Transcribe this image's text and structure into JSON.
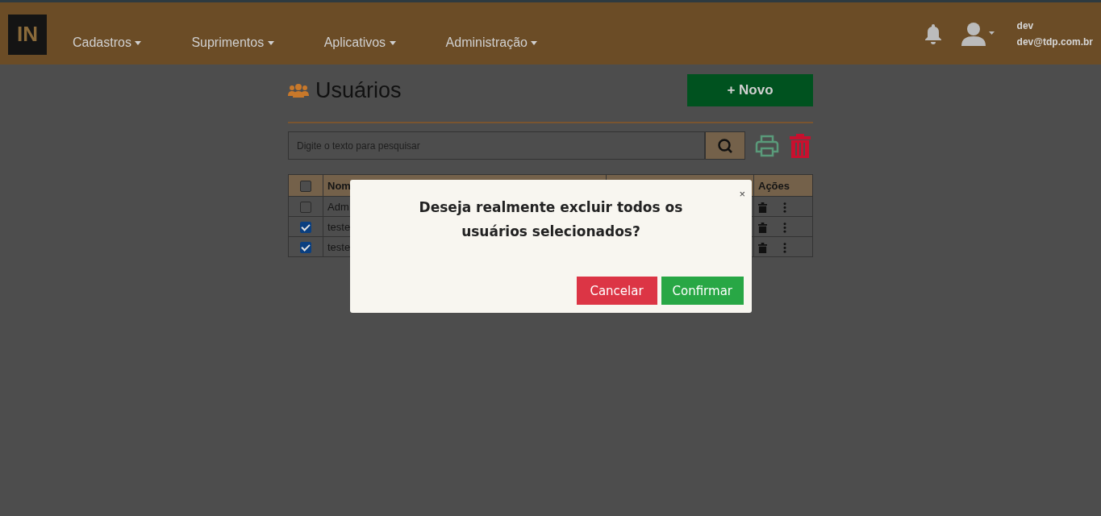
{
  "navbar": {
    "logo": "IN",
    "menus": [
      {
        "label": "Cadastros"
      },
      {
        "label": "Suprimentos"
      },
      {
        "label": "Aplicativos"
      },
      {
        "label": "Administração"
      }
    ],
    "user": {
      "name": "dev",
      "email": "dev@tdp.com.br"
    }
  },
  "page": {
    "title": "Usuários",
    "new_button": "+ Novo",
    "search": {
      "placeholder": "Digite o texto para pesquisar"
    }
  },
  "table": {
    "select_all": {
      "checked": false
    },
    "columns": [
      "Nom",
      "Ações"
    ],
    "rows": [
      {
        "name": "Adm",
        "checked": false
      },
      {
        "name": "teste",
        "checked": true
      },
      {
        "name": "teste",
        "checked": true
      }
    ]
  },
  "dialog": {
    "close": "×",
    "message": "Deseja realmente excluir todos os usuários selecionados?",
    "buttons": [
      {
        "label": "Cancelar",
        "kind": "cancel"
      },
      {
        "label": "Confirmar",
        "kind": "confirm"
      }
    ]
  }
}
